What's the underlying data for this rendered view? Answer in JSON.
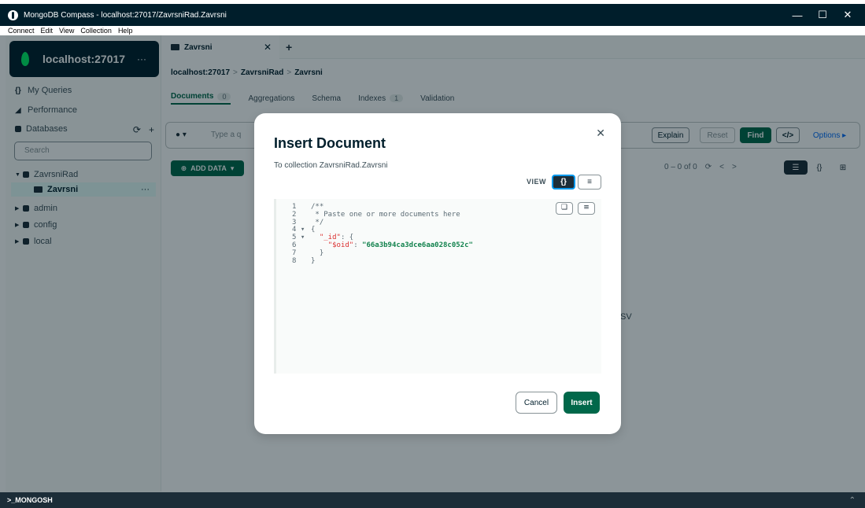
{
  "window": {
    "title": "MongoDB Compass - localhost:27017/ZavrsniRad.Zavrsni",
    "controls": [
      "—",
      "☐",
      "✕"
    ]
  },
  "menu": [
    "Connect",
    "Edit",
    "View",
    "Collection",
    "Help"
  ],
  "sidebar": {
    "connection": "localhost:27017",
    "more": "···",
    "my_queries": "My Queries",
    "performance": "Performance",
    "databases": "Databases",
    "search_placeholder": "Search",
    "tree": {
      "db_expanded": "ZavrsniRad",
      "collection_active": "Zavrsni",
      "others": [
        "admin",
        "config",
        "local"
      ]
    }
  },
  "tabs": {
    "active": "Zavrsni",
    "add": "+"
  },
  "breadcrumb": [
    "localhost:27017",
    "ZavrsniRad",
    "Zavrsni"
  ],
  "subtabs": [
    {
      "label": "Documents",
      "count": "0"
    },
    {
      "label": "Aggregations"
    },
    {
      "label": "Schema"
    },
    {
      "label": "Indexes",
      "count": "1"
    },
    {
      "label": "Validation"
    }
  ],
  "query": {
    "placeholder": "Type a q",
    "explain": "Explain",
    "reset": "Reset",
    "find": "Find",
    "options": "Options ▸"
  },
  "toolbar": {
    "add_data": "ADD DATA",
    "pager": "0 – 0 of 0"
  },
  "background_text": "SV",
  "mongosh": ">_MONGOSH",
  "modal": {
    "title": "Insert Document",
    "subtitle": "To collection ZavrsniRad.Zavrsni",
    "view_label": "VIEW",
    "editor_lines": [
      {
        "n": "1",
        "fold": "",
        "text": "/**"
      },
      {
        "n": "2",
        "fold": "",
        "text": " * Paste one or more documents here"
      },
      {
        "n": "3",
        "fold": "",
        "text": " */"
      },
      {
        "n": "4",
        "fold": "▾",
        "text": "{"
      },
      {
        "n": "5",
        "fold": "▾",
        "text": "  ",
        "key": "\"_id\"",
        "rest": ": {"
      },
      {
        "n": "6",
        "fold": "",
        "text": "    ",
        "key": "\"$oid\"",
        "rest": ": ",
        "str": "\"66a3b94ca3dce6aa028c052c\""
      },
      {
        "n": "7",
        "fold": "",
        "text": "  }"
      },
      {
        "n": "8",
        "fold": "",
        "text": "}"
      }
    ],
    "cancel": "Cancel",
    "insert": "Insert"
  },
  "colors": {
    "brand_dark": "#001e2b",
    "accent_green": "#00684a",
    "leaf_green": "#00ed64"
  }
}
